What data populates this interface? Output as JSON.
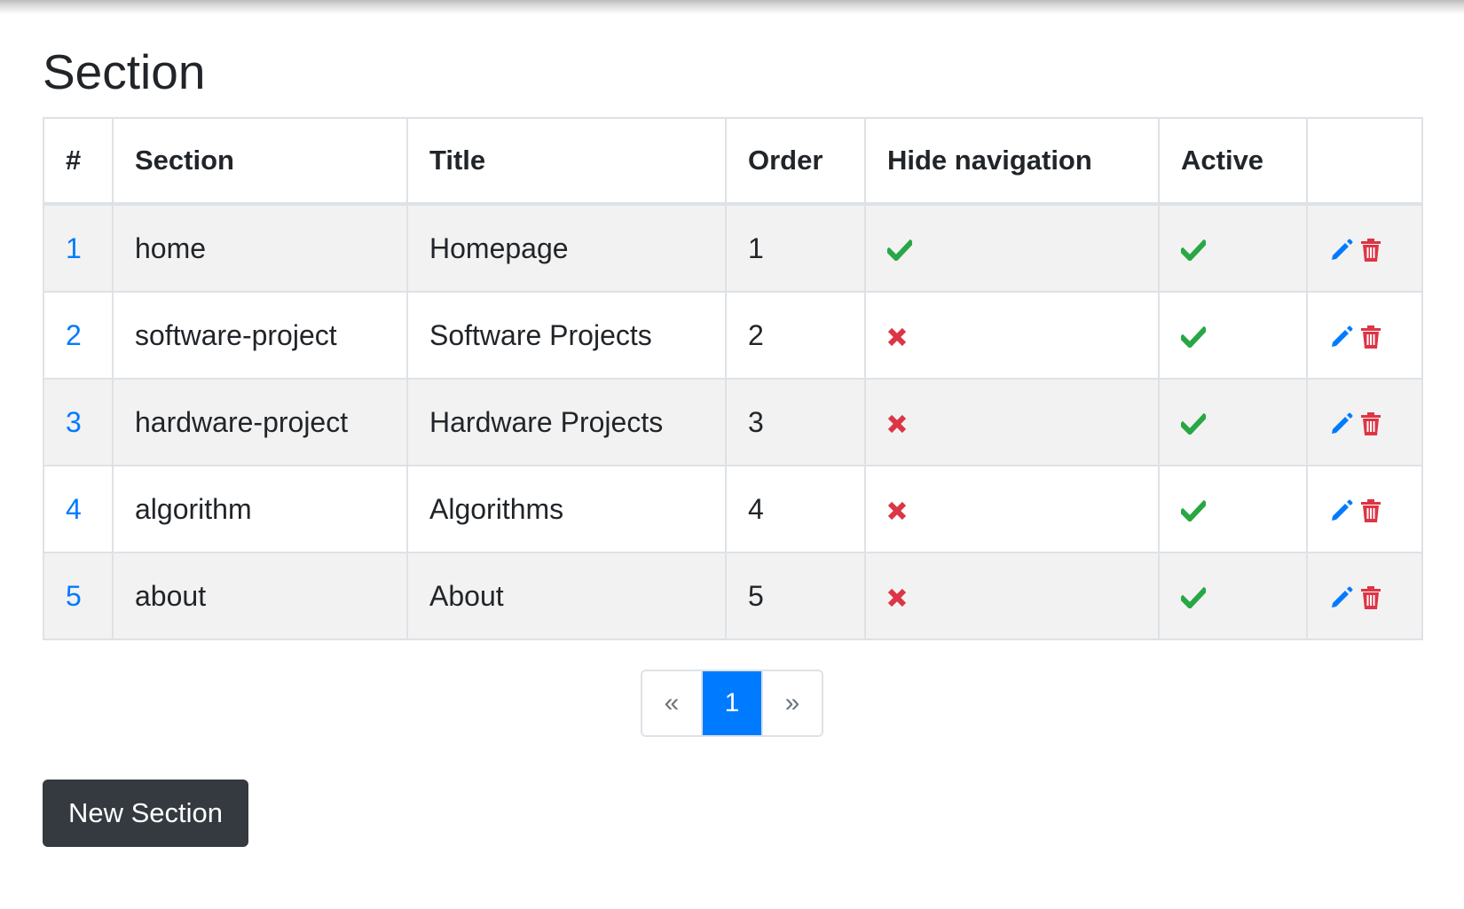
{
  "page": {
    "title": "Section"
  },
  "table": {
    "headers": [
      "#",
      "Section",
      "Title",
      "Order",
      "Hide navigation",
      "Active",
      ""
    ],
    "rows": [
      {
        "id": "1",
        "section": "home",
        "title": "Homepage",
        "order": "1",
        "hide_navigation": true,
        "active": true
      },
      {
        "id": "2",
        "section": "software-project",
        "title": "Software Projects",
        "order": "2",
        "hide_navigation": false,
        "active": true
      },
      {
        "id": "3",
        "section": "hardware-project",
        "title": "Hardware Projects",
        "order": "3",
        "hide_navigation": false,
        "active": true
      },
      {
        "id": "4",
        "section": "algorithm",
        "title": "Algorithms",
        "order": "4",
        "hide_navigation": false,
        "active": true
      },
      {
        "id": "5",
        "section": "about",
        "title": "About",
        "order": "5",
        "hide_navigation": false,
        "active": true
      }
    ],
    "row_actions": [
      "pencil-icon",
      "trash-icon"
    ]
  },
  "pagination": {
    "prev": "«",
    "current": "1",
    "next": "»"
  },
  "buttons": {
    "new_section": "New Section"
  },
  "colors": {
    "link": "#007bff",
    "check": "#28a745",
    "cross": "#dc3545",
    "edit": "#007bff",
    "delete": "#dc3545",
    "dark_button": "#343a40"
  }
}
